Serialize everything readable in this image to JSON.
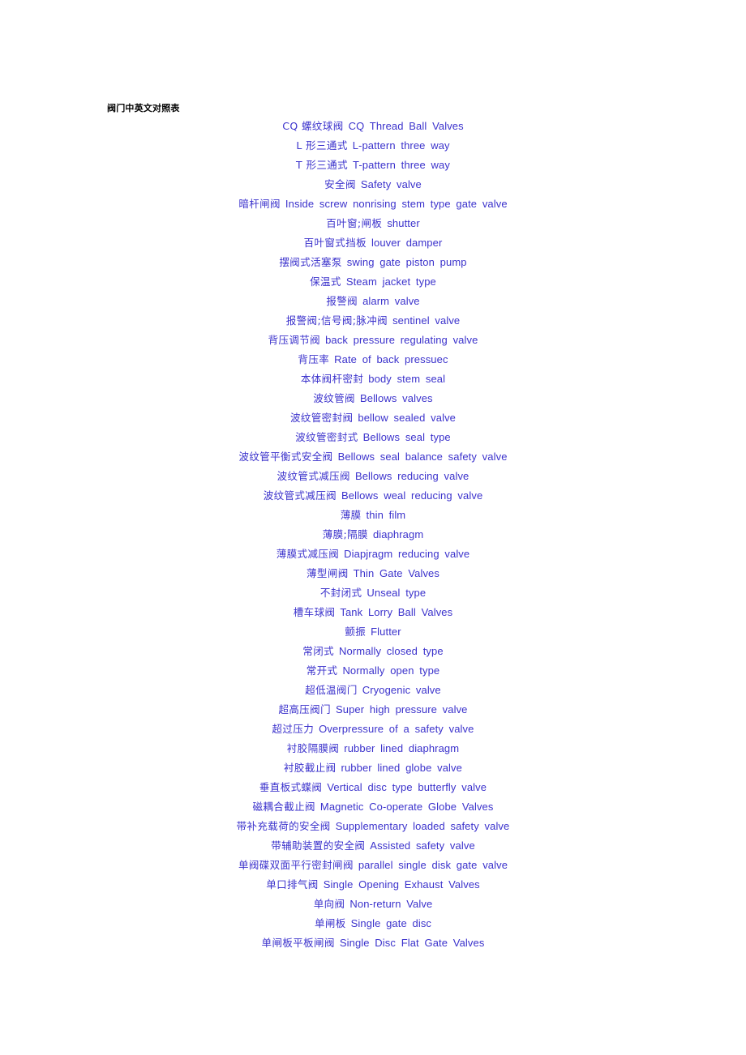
{
  "document": {
    "title": "阀门中英文对照表",
    "text_color": "#3b32cc",
    "title_color": "#000000",
    "background": "#ffffff"
  },
  "entries": [
    {
      "cn": "CQ 螺纹球阀",
      "en": "CQ Thread Ball Valves"
    },
    {
      "cn": "L 形三通式",
      "en": "L-pattern three way"
    },
    {
      "cn": "T 形三通式",
      "en": "T-pattern three way"
    },
    {
      "cn": "安全阀",
      "en": "Safety valve"
    },
    {
      "cn": "暗杆闸阀",
      "en": "Inside screw nonrising stem type gate valve"
    },
    {
      "cn": "百叶窗;闸板",
      "en": "shutter"
    },
    {
      "cn": "百叶窗式挡板",
      "en": "louver damper"
    },
    {
      "cn": "摆阀式活塞泵",
      "en": "swing gate piston pump"
    },
    {
      "cn": "保温式",
      "en": "Steam jacket type"
    },
    {
      "cn": "报警阀",
      "en": "alarm valve"
    },
    {
      "cn": "报警阀;信号阀;脉冲阀",
      "en": "sentinel valve"
    },
    {
      "cn": "背压调节阀",
      "en": "back pressure regulating valve"
    },
    {
      "cn": "背压率",
      "en": "Rate of back pressuec"
    },
    {
      "cn": "本体阀杆密封",
      "en": "body stem seal"
    },
    {
      "cn": "波纹管阀",
      "en": "Bellows valves"
    },
    {
      "cn": "波纹管密封阀",
      "en": "bellow sealed valve"
    },
    {
      "cn": "波纹管密封式",
      "en": "Bellows seal type"
    },
    {
      "cn": "波纹管平衡式安全阀",
      "en": "Bellows seal balance safety valve"
    },
    {
      "cn": "波纹管式减压阀",
      "en": "Bellows reducing valve"
    },
    {
      "cn": "波纹管式减压阀",
      "en": "Bellows weal reducing valve"
    },
    {
      "cn": "薄膜",
      "en": "thin film"
    },
    {
      "cn": "薄膜;隔膜",
      "en": "diaphragm"
    },
    {
      "cn": "薄膜式减压阀",
      "en": "Diapjragm reducing valve"
    },
    {
      "cn": "薄型闸阀",
      "en": "Thin Gate Valves"
    },
    {
      "cn": "不封闭式",
      "en": "Unseal type"
    },
    {
      "cn": "槽车球阀",
      "en": "Tank Lorry Ball Valves"
    },
    {
      "cn": "颤振",
      "en": "Flutter"
    },
    {
      "cn": "常闭式",
      "en": "Normally closed type"
    },
    {
      "cn": "常开式",
      "en": "Normally open type"
    },
    {
      "cn": "超低温阀门",
      "en": "Cryogenic valve"
    },
    {
      "cn": "超高压阀门",
      "en": "Super high pressure valve"
    },
    {
      "cn": "超过压力",
      "en": "Overpressure of a safety valve"
    },
    {
      "cn": "衬胶隔膜阀",
      "en": "rubber lined diaphragm"
    },
    {
      "cn": "衬胶截止阀",
      "en": "rubber lined globe valve"
    },
    {
      "cn": "垂直板式蝶阀",
      "en": "Vertical disc type butterfly valve"
    },
    {
      "cn": "磁耦合截止阀",
      "en": "Magnetic Co-operate Globe Valves"
    },
    {
      "cn": "带补充载荷的安全阀",
      "en": "Supplementary loaded safety valve"
    },
    {
      "cn": "带辅助装置的安全阀",
      "en": "Assisted safety valve"
    },
    {
      "cn": "单阀碟双面平行密封闸阀",
      "en": "parallel single disk gate valve"
    },
    {
      "cn": "单口排气阀",
      "en": "Single Opening Exhaust Valves"
    },
    {
      "cn": "单向阀",
      "en": "Non-return Valve"
    },
    {
      "cn": "单闸板",
      "en": "Single gate disc"
    },
    {
      "cn": "单闸板平板闸阀",
      "en": "Single Disc Flat Gate Valves"
    }
  ]
}
